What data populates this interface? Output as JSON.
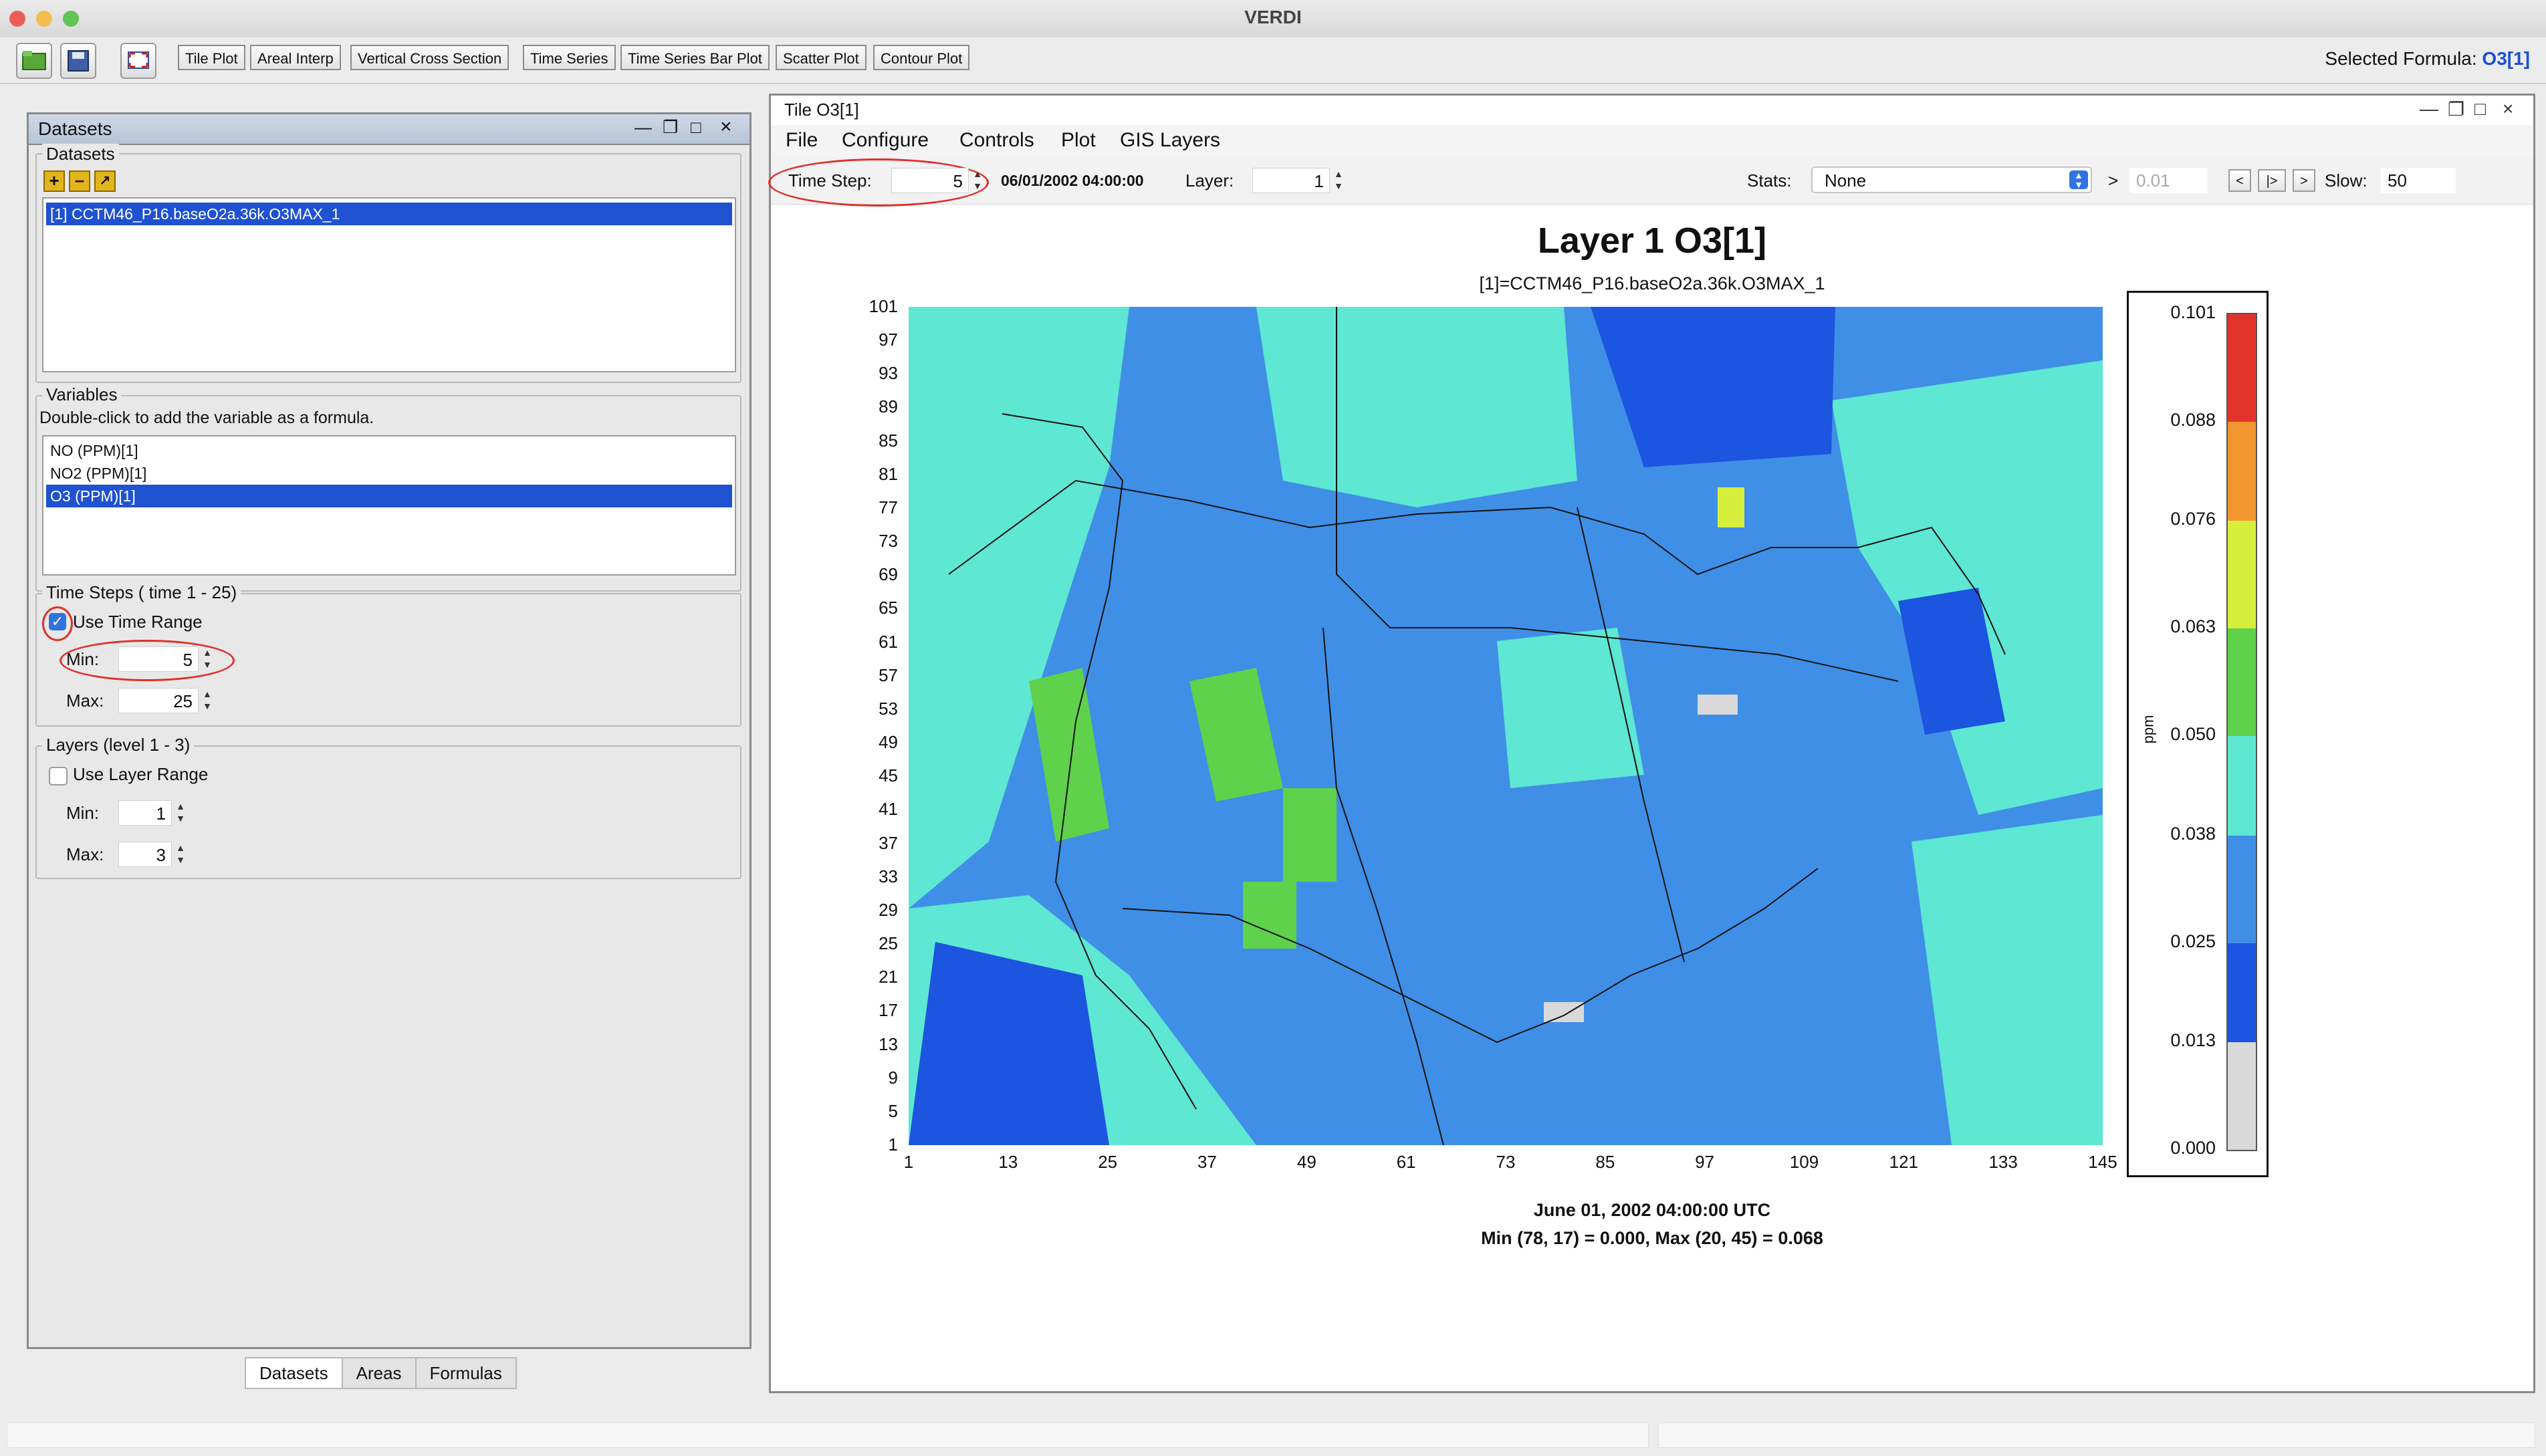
{
  "app": {
    "title": "VERDI",
    "selected_formula_label": "Selected Formula:",
    "selected_formula_value": "O3[1]"
  },
  "toolbar": {
    "icons": [
      "open-folder-icon",
      "save-icon",
      "fullscreen-icon"
    ],
    "plot_buttons": [
      "Tile Plot",
      "Areal Interp",
      "Vertical Cross Section",
      "Time Series",
      "Time Series Bar Plot",
      "Scatter Plot",
      "Contour Plot"
    ]
  },
  "left_panel": {
    "title": "Datasets",
    "datasets_group": {
      "title": "Datasets",
      "items": [
        "[1] CCTM46_P16.baseO2a.36k.O3MAX_1"
      ],
      "selected": 0
    },
    "variables_group": {
      "title": "Variables",
      "hint": "Double-click to add the variable as a formula.",
      "items": [
        "NO (PPM)[1]",
        "NO2 (PPM)[1]",
        "O3 (PPM)[1]"
      ],
      "selected": 2
    },
    "time_steps": {
      "title": "Time Steps ( time 1 - 25)",
      "use_range_label": "Use Time Range",
      "use_range_checked": true,
      "min_label": "Min:",
      "min_value": "5",
      "max_label": "Max:",
      "max_value": "25"
    },
    "layers": {
      "title": "Layers (level 1 - 3)",
      "use_range_label": "Use Layer Range",
      "use_range_checked": false,
      "min_label": "Min:",
      "min_value": "1",
      "max_label": "Max:",
      "max_value": "3"
    },
    "tabs": [
      "Datasets",
      "Areas",
      "Formulas"
    ],
    "active_tab": 0
  },
  "tile": {
    "title": "Tile O3[1]",
    "menus": [
      "File",
      "Configure",
      "Controls",
      "Plot",
      "GIS Layers"
    ],
    "controls": {
      "time_step_label": "Time Step:",
      "time_step_value": "5",
      "datetime": "06/01/2002 04:00:00",
      "layer_label": "Layer:",
      "layer_value": "1",
      "stats_label": "Stats:",
      "stats_value": "None",
      "gt_symbol": ">",
      "threshold": "0.01",
      "nav_buttons": [
        "<",
        "|>",
        ">"
      ],
      "slow_label": "Slow:",
      "slow_value": "50"
    },
    "plot": {
      "title": "Layer 1 O3[1]",
      "subtitle": "[1]=CCTM46_P16.baseO2a.36k.O3MAX_1",
      "footer_date": "June 01, 2002 04:00:00 UTC",
      "footer_stats": "Min (78, 17) = 0.000, Max (20, 45) = 0.068"
    }
  },
  "chart_data": {
    "type": "heatmap",
    "title": "Layer 1 O3[1]",
    "y_ticks": [
      "101",
      "97",
      "93",
      "89",
      "85",
      "81",
      "77",
      "73",
      "69",
      "65",
      "61",
      "57",
      "53",
      "49",
      "45",
      "41",
      "37",
      "33",
      "29",
      "25",
      "21",
      "17",
      "13",
      "9",
      "5",
      "1"
    ],
    "x_ticks": [
      "1",
      "13",
      "25",
      "37",
      "49",
      "61",
      "73",
      "85",
      "97",
      "109",
      "121",
      "133",
      "145"
    ],
    "xlim": [
      1,
      145
    ],
    "ylim": [
      1,
      101
    ],
    "legend": {
      "unit": "ppm",
      "labels": [
        "0.101",
        "0.088",
        "0.076",
        "0.063",
        "0.050",
        "0.038",
        "0.025",
        "0.013",
        "0.000"
      ],
      "bins": [
        {
          "from": 0.0,
          "to": 0.013,
          "color": "#d9d9d9"
        },
        {
          "from": 0.013,
          "to": 0.025,
          "color": "#1c55e0"
        },
        {
          "from": 0.025,
          "to": 0.038,
          "color": "#3f8fe6"
        },
        {
          "from": 0.038,
          "to": 0.05,
          "color": "#5ee7d2"
        },
        {
          "from": 0.05,
          "to": 0.063,
          "color": "#5fd14a"
        },
        {
          "from": 0.063,
          "to": 0.076,
          "color": "#d6ef3c"
        },
        {
          "from": 0.076,
          "to": 0.088,
          "color": "#f2962f"
        },
        {
          "from": 0.088,
          "to": 0.101,
          "color": "#e2332b"
        }
      ]
    },
    "min": {
      "col": 78,
      "row": 17,
      "value": 0.0
    },
    "max": {
      "col": 20,
      "row": 45,
      "value": 0.068
    }
  }
}
